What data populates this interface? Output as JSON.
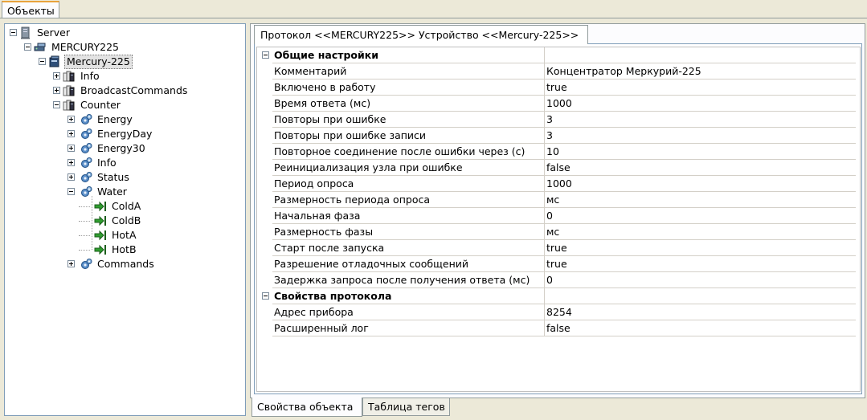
{
  "top_tab": {
    "label": "Объекты"
  },
  "tree": [
    {
      "label": "Server",
      "icon": "server-icon",
      "toggle": "minus"
    },
    {
      "label": "MERCURY225",
      "icon": "network-protocol-icon",
      "toggle": "minus"
    },
    {
      "label": "Mercury-225",
      "icon": "device-icon",
      "toggle": "minus",
      "selected": true
    },
    {
      "label": "Info",
      "icon": "folder-group-icon",
      "toggle": "plus"
    },
    {
      "label": "BroadcastCommands",
      "icon": "folder-group-icon",
      "toggle": "plus"
    },
    {
      "label": "Counter",
      "icon": "folder-group-icon",
      "toggle": "minus"
    },
    {
      "label": "Energy",
      "icon": "gear-group-icon",
      "toggle": "plus"
    },
    {
      "label": "EnergyDay",
      "icon": "gear-group-icon",
      "toggle": "plus"
    },
    {
      "label": "Energy30",
      "icon": "gear-group-icon",
      "toggle": "plus"
    },
    {
      "label": "Info",
      "icon": "gear-group-icon",
      "toggle": "plus"
    },
    {
      "label": "Status",
      "icon": "gear-group-icon",
      "toggle": "plus"
    },
    {
      "label": "Water",
      "icon": "gear-group-icon",
      "toggle": "minus"
    },
    {
      "label": "ColdA",
      "icon": "tag-arrow-icon",
      "toggle": "none"
    },
    {
      "label": "ColdB",
      "icon": "tag-arrow-icon",
      "toggle": "none"
    },
    {
      "label": "HotA",
      "icon": "tag-arrow-icon",
      "toggle": "none"
    },
    {
      "label": "HotB",
      "icon": "tag-arrow-icon",
      "toggle": "none"
    },
    {
      "label": "Commands",
      "icon": "gear-group-icon",
      "toggle": "plus"
    }
  ],
  "protocol_tab": {
    "label": "Протокол <<MERCURY225>> Устройство <<Mercury-225>>"
  },
  "property_grid": {
    "categories": [
      {
        "title": "Общие настройки",
        "rows": [
          {
            "name": "Комментарий",
            "value": "Концентратор Меркурий-225"
          },
          {
            "name": "Включено в работу",
            "value": "true"
          },
          {
            "name": "Время ответа (мс)",
            "value": "1000"
          },
          {
            "name": "Повторы при ошибке",
            "value": "3"
          },
          {
            "name": "Повторы при ошибке записи",
            "value": "3"
          },
          {
            "name": "Повторное соединение после ошибки через (с)",
            "value": "10"
          },
          {
            "name": "Реинициализация узла при ошибке",
            "value": "false"
          },
          {
            "name": "Период опроса",
            "value": "1000"
          },
          {
            "name": "Размерность периода опроса",
            "value": "мс"
          },
          {
            "name": "Начальная фаза",
            "value": "0"
          },
          {
            "name": "Размерность фазы",
            "value": "мс"
          },
          {
            "name": "Старт после запуска",
            "value": "true"
          },
          {
            "name": "Разрешение отладочных сообщений",
            "value": "true"
          },
          {
            "name": "Задержка запроса после получения ответа (мс)",
            "value": "0"
          }
        ]
      },
      {
        "title": "Свойства протокола",
        "rows": [
          {
            "name": "Адрес прибора",
            "value": "8254"
          },
          {
            "name": "Расширенный лог",
            "value": "false"
          }
        ]
      }
    ]
  },
  "bottom_tabs": [
    {
      "label": "Свойства объекта",
      "active": true
    },
    {
      "label": "Таблица тегов",
      "active": false
    }
  ]
}
